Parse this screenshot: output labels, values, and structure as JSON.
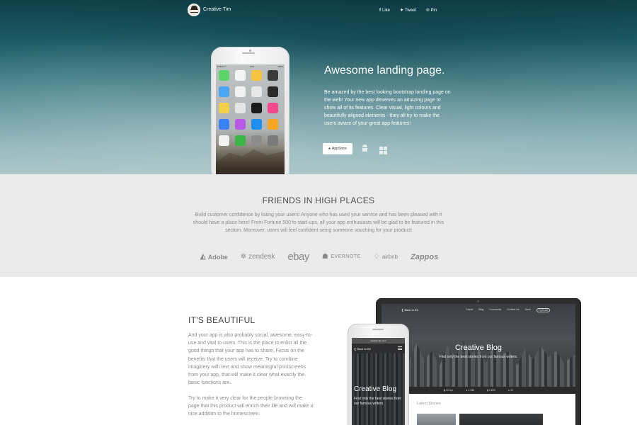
{
  "nav": {
    "brand": "Creative Tim",
    "links": [
      {
        "label": "Like",
        "icon": "facebook-icon",
        "glyph": "f"
      },
      {
        "label": "Tweet",
        "icon": "twitter-icon",
        "glyph": "✦"
      },
      {
        "label": "Pin",
        "icon": "pinterest-icon",
        "glyph": "℗"
      }
    ]
  },
  "hero": {
    "title": "Awesome landing page.",
    "text": "Be amazed by the best looking bootstrap landing page on the web! Your new app deserves an amazing page to show all of its features. Clear visual, light colours and beautifully aligned elements - they all try to make the users aware of your great app features!",
    "appstore_label": "AppStore",
    "phone_status": {
      "left": "●●●●● ᯤ",
      "center": "9:41",
      "right": "100%"
    },
    "app_colors": [
      "#5fd26a",
      "#f5f5f5",
      "#f6c343",
      "#3a3a3a",
      "#4da6f2",
      "#f2f2f2",
      "#e8e8e8",
      "#2b2b2b",
      "#f2d04a",
      "#e6e6e6",
      "#1a1a1a",
      "#f04a8a",
      "#3b82f6",
      "#b65ae6",
      "#1e8ef0",
      "#f5a623",
      "#f2f2f2",
      "#3bb54a",
      "#8c8c8c",
      "#7a7a7a"
    ]
  },
  "friends": {
    "title": "FRIENDS IN HIGH PLACES",
    "text": "Build customer confidence by listing your users! Anyone who has used your service and has been pleased with it should have a place here! From Fortune 500 to start-ups, all your app enthusiasts will be glad to be featured in this section. Moreover, users will feel confident seing someone vouching for your product!",
    "logos": [
      {
        "name": "Adobe",
        "symbol": "◭"
      },
      {
        "name": "zendesk",
        "symbol": "✲"
      },
      {
        "name": "ebay",
        "symbol": ""
      },
      {
        "name": "EVERNOTE",
        "symbol": "☗"
      },
      {
        "name": "airbnb",
        "symbol": "♢"
      },
      {
        "name": "Zappos",
        "symbol": ""
      }
    ]
  },
  "beautiful": {
    "title": "IT'S BEAUTIFUL",
    "text1": "And your app is also probably social, awesome, easy-to-use and vital to users. This is the place to enlist all the good things that your app has to share. Focus on the benefits that the users will receive. Try to combine imaginery with text and show meaningful printscreens from your app, that will make it clear what exactly the basic functions are.",
    "text2": "Try to make it very clear for the people browsing the page that this product will enrich their life and will make a nice addition to the homescreen."
  },
  "tablet": {
    "back_label": "❮ Back to Kit",
    "menu": [
      "Home",
      "Blog",
      "Comments",
      "Contact Us",
      "Docs",
      "Try it out"
    ],
    "blog_title": "Creative Blog",
    "blog_sub": "Find only the best stories from our famous writers.",
    "strip": [
      "▮ 22 Apr",
      "● 2,358",
      "▮ 9,853",
      "● 49"
    ],
    "latest": "Latest Stories"
  },
  "mini_phone": {
    "topbar": "creative-tim.com",
    "back_label": "❮ Back to Kit",
    "title": "Creative Blog",
    "sub": "Find only the best stories from our famous writers."
  }
}
